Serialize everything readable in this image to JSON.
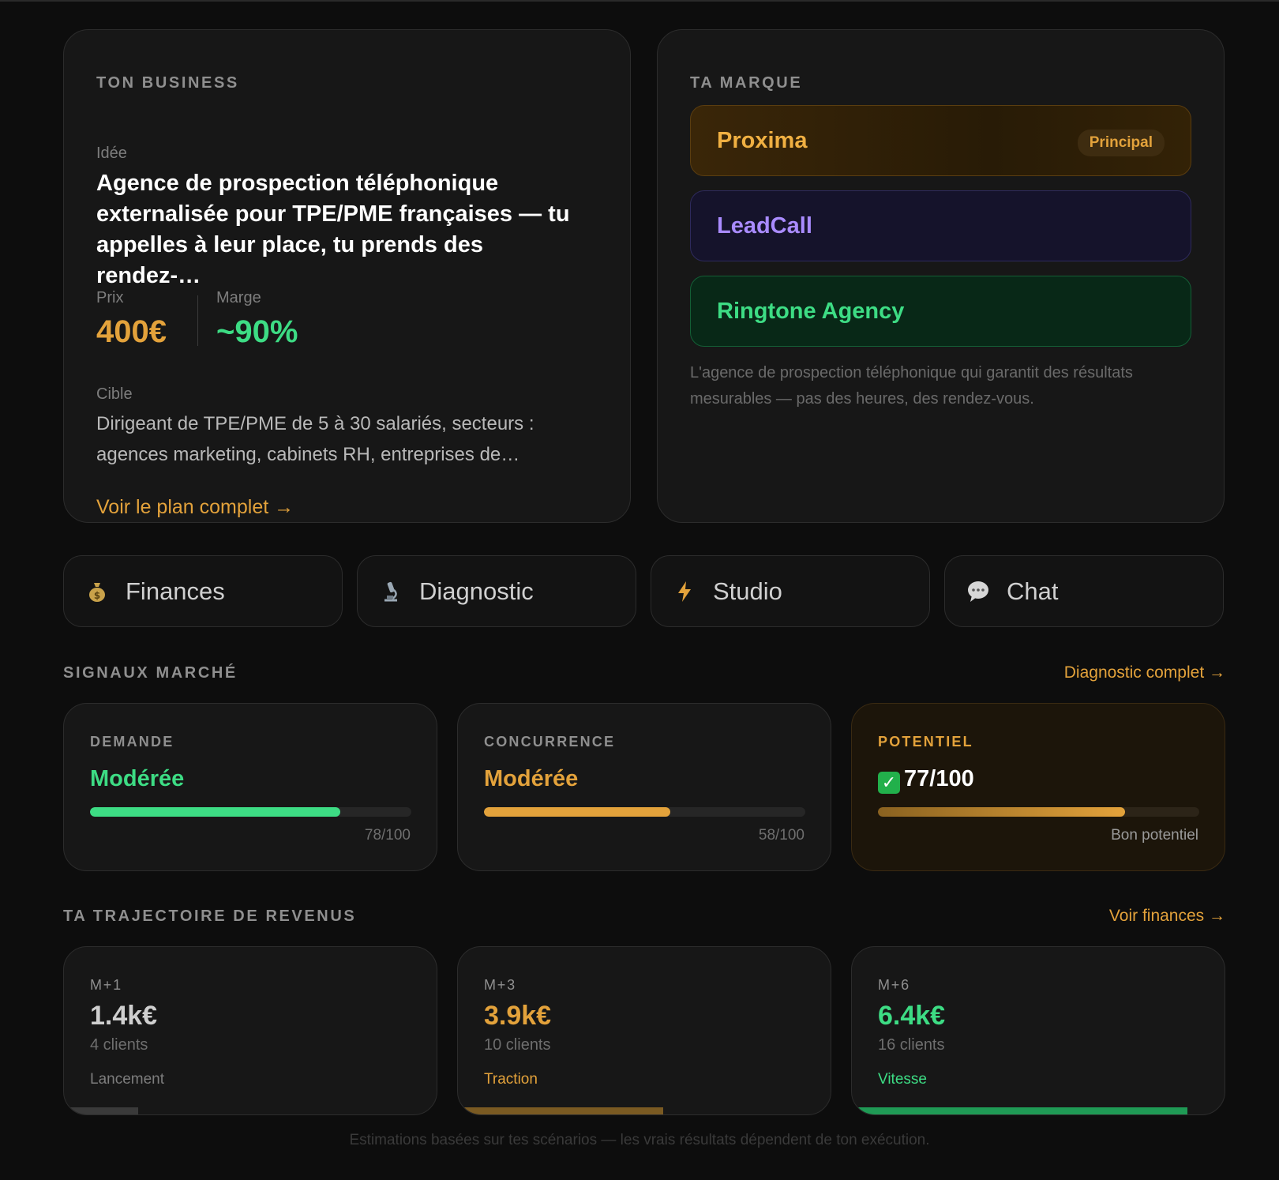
{
  "colors": {
    "accent": "#e3a23b",
    "green": "#3ddc84",
    "purple": "#a98bff",
    "background": "#0d0d0d",
    "card": "#171717"
  },
  "business": {
    "section_label": "TON BUSINESS",
    "idea_label": "Idée",
    "idea_text": "Agence de prospection téléphonique externalisée pour TPE/PME françaises — tu appelles à leur place, tu prends des rendez-…",
    "price_label": "Prix",
    "price_value": "400€",
    "margin_label": "Marge",
    "margin_value": "~90%",
    "target_label": "Cible",
    "target_text": "Dirigeant de TPE/PME de 5 à 30 salariés, secteurs : agences marketing, cabinets RH, entreprises de…",
    "plan_link": "Voir le plan complet →"
  },
  "brand": {
    "section_label": "TA MARQUE",
    "options": [
      {
        "name": "Proxima",
        "badge": "Principal"
      },
      {
        "name": "LeadCall"
      },
      {
        "name": "Ringtone Agency"
      }
    ],
    "tagline": "L'agence de prospection téléphonique qui garantit des résultats mesurables — pas des heures, des rendez-vous."
  },
  "nav": [
    {
      "label": "Finances",
      "icon": "money-bag-icon"
    },
    {
      "label": "Diagnostic",
      "icon": "microscope-icon"
    },
    {
      "label": "Studio",
      "icon": "lightning-icon"
    },
    {
      "label": "Chat",
      "icon": "speech-bubble-icon"
    }
  ],
  "signals": {
    "title": "SIGNAUX MARCHÉ",
    "link": "Diagnostic complet →",
    "cards": [
      {
        "label": "DEMANDE",
        "value": "Modérée",
        "score": 78,
        "foot": "78/100",
        "color": "#3ddc84"
      },
      {
        "label": "CONCURRENCE",
        "value": "Modérée",
        "score": 58,
        "foot": "58/100",
        "color": "#e3a23b"
      },
      {
        "label": "POTENTIEL",
        "value": "77/100",
        "score": 77,
        "foot": "Bon potentiel",
        "color": "#e3a23b"
      }
    ]
  },
  "trajectory": {
    "title": "TA TRAJECTOIRE DE REVENUS",
    "link": "Voir finances →",
    "cards": [
      {
        "month": "M+1",
        "amount": "1.4k€",
        "clients": "4 clients",
        "phase": "Lancement",
        "progress": 0.2,
        "amount_color": "#cfcfcf",
        "phase_color": "#7d7d7d",
        "bar_color": "#3a3a3a"
      },
      {
        "month": "M+3",
        "amount": "3.9k€",
        "clients": "10 clients",
        "phase": "Traction",
        "progress": 0.55,
        "amount_color": "#e3a23b",
        "phase_color": "#e3a23b",
        "bar_color": "#7a5a22"
      },
      {
        "month": "M+6",
        "amount": "6.4k€",
        "clients": "16 clients",
        "phase": "Vitesse",
        "progress": 0.9,
        "amount_color": "#3ddc84",
        "phase_color": "#3ddc84",
        "bar_color": "#1f9a55"
      }
    ]
  },
  "footnote": "Estimations basées sur tes scénarios — les vrais résultats dépendent de ton exécution."
}
